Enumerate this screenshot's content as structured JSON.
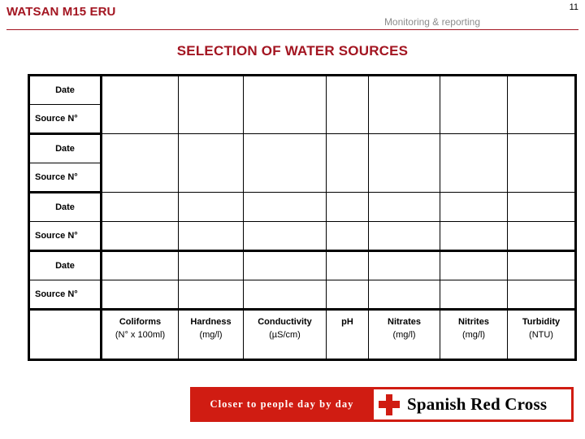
{
  "header": {
    "title": "WATSAN M15 ERU",
    "subtitle": "Monitoring & reporting",
    "slide_number": "11",
    "rule_color": "#a31521"
  },
  "slide": {
    "title": "SELECTION OF WATER SOURCES",
    "title_color": "#a31521"
  },
  "table": {
    "row_labels": [
      {
        "label": "Date",
        "type": "date"
      },
      {
        "label": "Source N°",
        "type": "source"
      },
      {
        "label": "Date",
        "type": "date"
      },
      {
        "label": "Source N°",
        "type": "source"
      },
      {
        "label": "Date",
        "type": "date"
      },
      {
        "label": "Source N°",
        "type": "source"
      },
      {
        "label": "Date",
        "type": "date"
      },
      {
        "label": "Source N°",
        "type": "source"
      }
    ],
    "measure_columns": [
      {
        "name": "Coliforms",
        "unit": "(N° x 100ml)"
      },
      {
        "name": "Hardness",
        "unit": "(mg/l)"
      },
      {
        "name": "Conductivity",
        "unit": "(µS/cm)"
      },
      {
        "name": "pH",
        "unit": ""
      },
      {
        "name": "Nitrates",
        "unit": "(mg/l)"
      },
      {
        "name": "Nitrites",
        "unit": "(mg/l)"
      },
      {
        "name": "Turbidity",
        "unit": "(NTU)"
      }
    ],
    "cell_values": [
      [
        "",
        "",
        "",
        "",
        "",
        "",
        ""
      ],
      [
        "",
        "",
        "",
        "",
        "",
        "",
        ""
      ],
      [
        "",
        "",
        "",
        "",
        "",
        "",
        ""
      ],
      [
        "",
        "",
        "",
        "",
        "",
        "",
        ""
      ],
      [
        "",
        "",
        "",
        "",
        "",
        "",
        ""
      ],
      [
        "",
        "",
        "",
        "",
        "",
        "",
        ""
      ],
      [
        "",
        "",
        "",
        "",
        "",
        "",
        ""
      ],
      [
        "",
        "",
        "",
        "",
        "",
        "",
        ""
      ]
    ],
    "border_color": "#000000"
  },
  "footer": {
    "tagline": "Closer to people day by day",
    "brand_name": "Spanish Red Cross",
    "emblem": "red-cross-emblem",
    "banner_color": "#d01c12",
    "box_color": "#ffffff"
  }
}
